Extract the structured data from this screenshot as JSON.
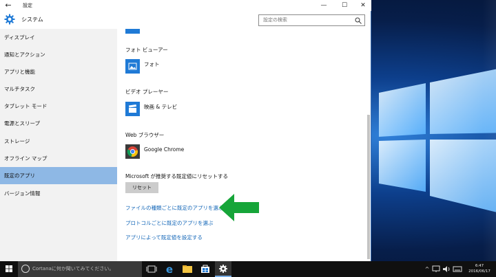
{
  "window": {
    "title": "設定",
    "back_icon": "←",
    "minimize_icon": "—",
    "maximize_icon": "☐",
    "close_icon": "✕"
  },
  "header": {
    "title": "システム",
    "search_placeholder": "設定の検索"
  },
  "sidebar": {
    "items": [
      {
        "label": "ディスプレイ"
      },
      {
        "label": "通知とアクション"
      },
      {
        "label": "アプリと機能"
      },
      {
        "label": "マルチタスク"
      },
      {
        "label": "タブレット モード"
      },
      {
        "label": "電源とスリープ"
      },
      {
        "label": "ストレージ"
      },
      {
        "label": "オフライン マップ"
      },
      {
        "label": "既定のアプリ",
        "active": true
      },
      {
        "label": "バージョン情報"
      }
    ]
  },
  "main": {
    "photo_viewer": {
      "label": "フォト ビューアー",
      "app": "フォト"
    },
    "video_player": {
      "label": "ビデオ プレーヤー",
      "app": "映画 & テレビ"
    },
    "web_browser": {
      "label": "Web ブラウザー",
      "app": "Google Chrome"
    },
    "reset_label": "Microsoft が推奨する既定値にリセットする",
    "reset_button": "リセット",
    "links": [
      "ファイルの種類ごとに既定のアプリを選ぶ",
      "プロトコルごとに既定のアプリを選ぶ",
      "アプリによって既定値を設定する"
    ]
  },
  "taskbar": {
    "cortana_placeholder": "Cortanaに何か聞いてみてください。",
    "time": "6:47",
    "date": "2016/06/17"
  },
  "colors": {
    "accent": "#1f7ad6",
    "link": "#1467b8",
    "active_nav": "#8eb8e5",
    "annotation_arrow": "#16a539"
  }
}
